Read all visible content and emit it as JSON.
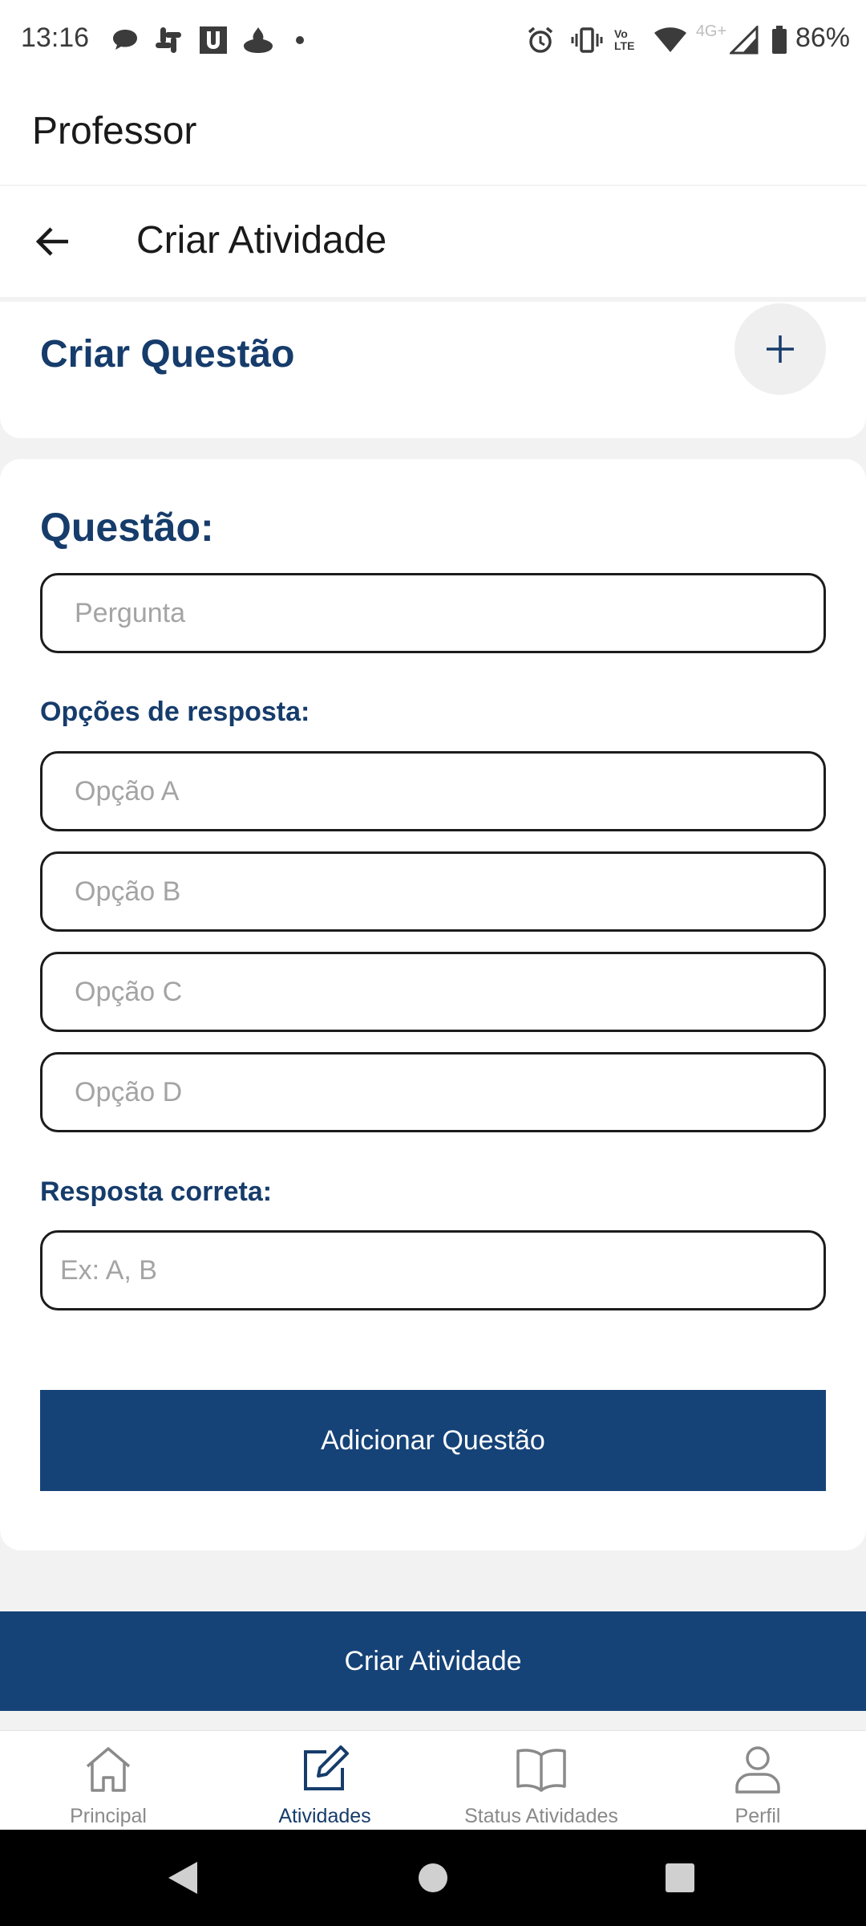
{
  "status_bar": {
    "time": "13:16",
    "battery": "86%",
    "network_label": "4G+",
    "volte_label": "Vo LTE",
    "notification_icons": [
      "chat-bubble-icon",
      "slack-icon",
      "u-app-icon",
      "santander-icon",
      "dot-icon"
    ],
    "system_icons": [
      "alarm-icon",
      "vibrate-icon",
      "volte-icon",
      "wifi-icon",
      "signal-icon",
      "battery-icon"
    ]
  },
  "app_header": {
    "title": "Professor"
  },
  "page_header": {
    "title": "Criar Atividade",
    "back_icon": "arrow-left-icon"
  },
  "create_question": {
    "title": "Criar Questão",
    "add_icon": "plus-icon"
  },
  "question_form": {
    "question_label": "Questão:",
    "question_placeholder": "Pergunta",
    "options_label": "Opções de resposta:",
    "options": [
      {
        "placeholder": "Opção A"
      },
      {
        "placeholder": "Opção B"
      },
      {
        "placeholder": "Opção C"
      },
      {
        "placeholder": "Opção D"
      }
    ],
    "correct_label": "Resposta correta:",
    "correct_placeholder": "Ex: A, B",
    "add_button": "Adicionar Questão"
  },
  "create_activity_button": "Criar Atividade",
  "bottom_nav": {
    "active": "Atividades",
    "items": [
      {
        "label": "Principal",
        "icon": "home-icon"
      },
      {
        "label": "Atividades",
        "icon": "edit-icon"
      },
      {
        "label": "Status Atividades",
        "icon": "book-icon"
      },
      {
        "label": "Perfil",
        "icon": "person-icon"
      }
    ]
  },
  "colors": {
    "primary": "#164377",
    "heading": "#163c6b",
    "background": "#f2f2f2",
    "nav_inactive": "#8a8a8a"
  }
}
